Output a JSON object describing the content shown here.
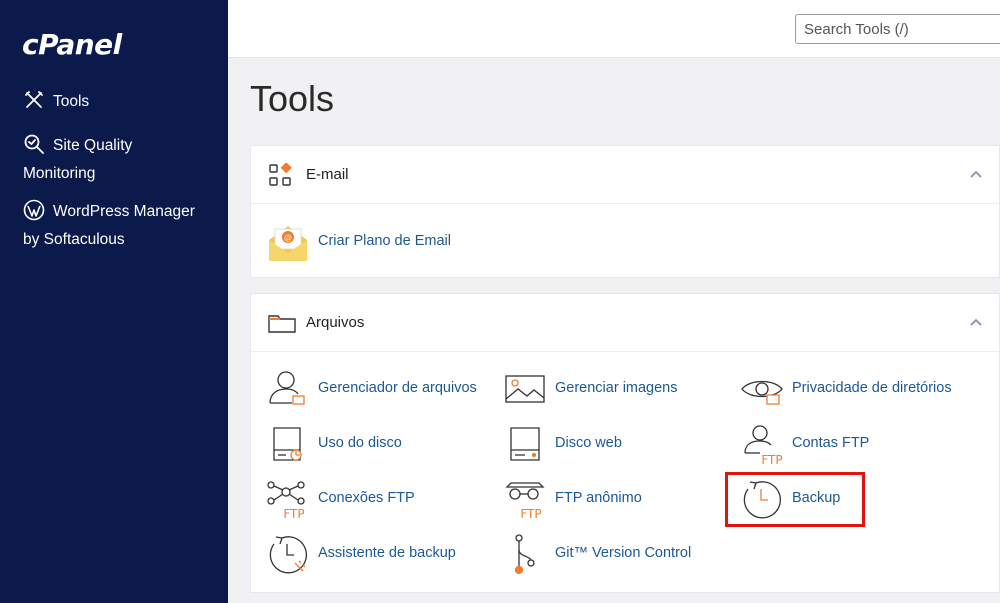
{
  "sidebar": {
    "logo": "cPanel",
    "items": [
      {
        "label": "Tools",
        "icon": "tools-icon"
      },
      {
        "label_line1": "Site Quality",
        "label_line2": "Monitoring",
        "icon": "magnifier-icon"
      },
      {
        "label_line1": "WordPress Manager",
        "label_line2": "by Softaculous",
        "icon": "wordpress-icon"
      }
    ]
  },
  "topbar": {
    "search_placeholder": "Search Tools (/)"
  },
  "page": {
    "title": "Tools"
  },
  "panels": {
    "email": {
      "title": "E-mail",
      "tools": [
        {
          "label": "Criar Plano de Email",
          "icon": "email-envelope-icon"
        }
      ]
    },
    "files": {
      "title": "Arquivos",
      "tools": [
        {
          "label": "Gerenciador de arquivos",
          "icon": "file-manager-icon"
        },
        {
          "label": "Gerenciar imagens",
          "icon": "images-icon"
        },
        {
          "label": "Privacidade de diretórios",
          "icon": "directory-privacy-icon"
        },
        {
          "label": "Uso do disco",
          "icon": "disk-usage-icon"
        },
        {
          "label": "Disco web",
          "icon": "web-disk-icon"
        },
        {
          "label": "Contas FTP",
          "icon": "ftp-accounts-icon"
        },
        {
          "label": "Conexões FTP",
          "icon": "ftp-connections-icon"
        },
        {
          "label": "FTP anônimo",
          "icon": "anonymous-ftp-icon"
        },
        {
          "label": "Backup",
          "icon": "backup-icon"
        },
        {
          "label": "Assistente de backup",
          "icon": "backup-wizard-icon"
        },
        {
          "label": "Git™ Version Control",
          "icon": "git-icon"
        }
      ]
    }
  },
  "colors": {
    "sidebar": "#0b1a4a",
    "link": "#1c5896",
    "accent": "#f07d2e",
    "highlight": "#e0140f"
  },
  "icon_labels": {
    "ftp": "FTP"
  }
}
